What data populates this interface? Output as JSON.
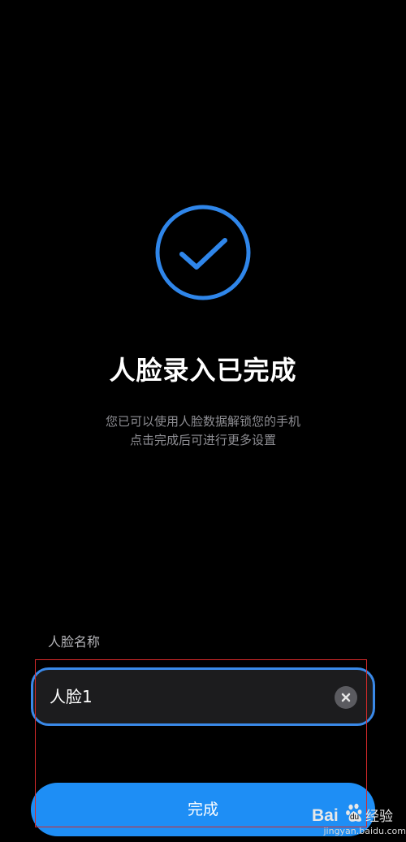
{
  "success": {
    "icon": "check-circle-icon",
    "accent_color": "#2f86ea",
    "title": "人脸录入已完成",
    "description_lines": [
      "您已可以使用人脸数据解锁您的手机",
      "点击完成后可进行更多设置"
    ]
  },
  "form": {
    "name_label": "人脸名称",
    "name_value": "人脸1",
    "clear_icon": "clear-icon"
  },
  "actions": {
    "done_label": "完成",
    "done_color": "#1e8ef5"
  },
  "watermark": {
    "logo_text": "Bai du 经验",
    "url": "jingyan.baidu.com"
  }
}
